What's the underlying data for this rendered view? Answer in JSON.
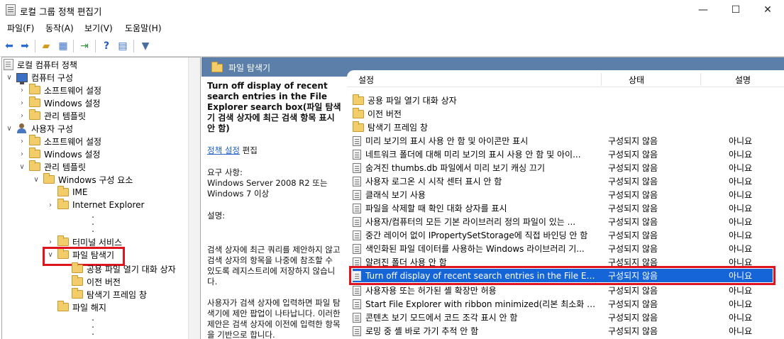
{
  "window": {
    "title": "로컬 그룹 정책 편집기",
    "minimize_icon": "minimize-icon",
    "maximize_icon": "maximize-icon",
    "close_icon": "close-icon"
  },
  "menu": [
    "파일(F)",
    "동작(A)",
    "보기(V)",
    "도움말(H)"
  ],
  "toolbar": {
    "icons": [
      "back-icon",
      "forward-icon",
      "up-folder-icon",
      "show-hide-tree-icon",
      "export-list-icon",
      "help-icon",
      "properties-icon",
      "filter-icon"
    ]
  },
  "tree": {
    "root": "로컬 컴퓨터 정책",
    "computer_config": "컴퓨터 구성",
    "cc_software": "소프트웨어 설정",
    "cc_windows": "Windows 설정",
    "cc_admin": "관리 템플릿",
    "user_config": "사용자 구성",
    "uc_software": "소프트웨어 설정",
    "uc_windows": "Windows 설정",
    "uc_admin": "관리 템플릿",
    "win_components": "Windows 구성 요소",
    "ime": "IME",
    "ie": "Internet Explorer",
    "terminal": "터미널 서비스",
    "file_explorer": "파일 탐색기",
    "common_open": "공용 파일 열기 대화 상자",
    "prev_version": "이전 버전",
    "explorer_frame": "탐색기 프레임 창",
    "file_release": "파일 해지"
  },
  "header": {
    "folder_title": "파일 탐색기"
  },
  "description": {
    "title": "Turn off display of recent search entries in the File Explorer search box(파일 탐색기 검색 상자에 최근 검색 항목 표시 안 함)",
    "link": "정책 설정",
    "edit": "편집",
    "req_label": "요구 사항:",
    "req_text": "Windows Server 2008 R2 또는 Windows 7 이상",
    "desc_label": "설명:",
    "para1": "검색 상자에 최근 쿼리를 제안하지 않고 검색 상자의 항목을 나중에 참조할 수 있도록 레지스트리에 저장하지 않습니다.",
    "para2": "사용자가 검색 상자에 입력하면 파일 탐색기에 제안 팝업이 나타납니다. 이러한 제안은 검색 상자에 이전에 입력한 항목을 기반으로 합니다."
  },
  "list": {
    "col_setting": "설정",
    "col_state": "상태",
    "col_comment": "설명",
    "folders": [
      "공용 파일 열기 대화 상자",
      "이전 버전",
      "탐색기 프레임 창"
    ],
    "rows": [
      {
        "name": "미리 보기의 표시 사용 안 함 및 아이콘만 표시",
        "state": "구성되지 않음",
        "comment": "아니요"
      },
      {
        "name": "네트워크 폴더에 대해 미리 보기의 표시 사용 안 함 및 아이...",
        "state": "구성되지 않음",
        "comment": "아니요"
      },
      {
        "name": "숨겨진 thumbs.db 파일에서 미리 보기 캐싱 끄기",
        "state": "구성되지 않음",
        "comment": "아니요"
      },
      {
        "name": "사용자 로그온 시 시작 센터 표시 안 함",
        "state": "구성되지 않음",
        "comment": "아니요"
      },
      {
        "name": "클래식 보기 사용",
        "state": "구성되지 않음",
        "comment": "아니요"
      },
      {
        "name": "파일을 삭제할 때 확인 대화 상자를 표시",
        "state": "구성되지 않음",
        "comment": "아니요"
      },
      {
        "name": "사용자/컴퓨터의 모든 기본 라이브러리 정의 파일이 있는 ...",
        "state": "구성되지 않음",
        "comment": "아니요"
      },
      {
        "name": "중간 레이어 없이 IPropertySetStorage에 직접 바인딩 안 함",
        "state": "구성되지 않음",
        "comment": "아니요"
      },
      {
        "name": "색인화된 파일 데이터를 사용하는 Windows 라이브러리 기...",
        "state": "구성되지 않음",
        "comment": "아니요"
      },
      {
        "name": "알려진 폴더 사용 안 함",
        "state": "구성되지 않음",
        "comment": "아니요"
      },
      {
        "name": "Turn off display of recent search entries in the File Explorer...",
        "state": "구성되지 않음",
        "comment": "아니요"
      },
      {
        "name": "사용자용 또는 허가된 셸 확장만 허용",
        "state": "구성되지 않음",
        "comment": "아니요"
      },
      {
        "name": "Start File Explorer with ribbon minimized(리본 최소화 상태...",
        "state": "구성되지 않음",
        "comment": "아니요"
      },
      {
        "name": "콘텐츠 보기 모드에서 코드 조각 표시 안 함",
        "state": "구성되지 않음",
        "comment": "아니요"
      },
      {
        "name": "로밍 중 셸 바로 가기 추적 안 함",
        "state": "구성되지 않음",
        "comment": "아니요"
      }
    ]
  }
}
